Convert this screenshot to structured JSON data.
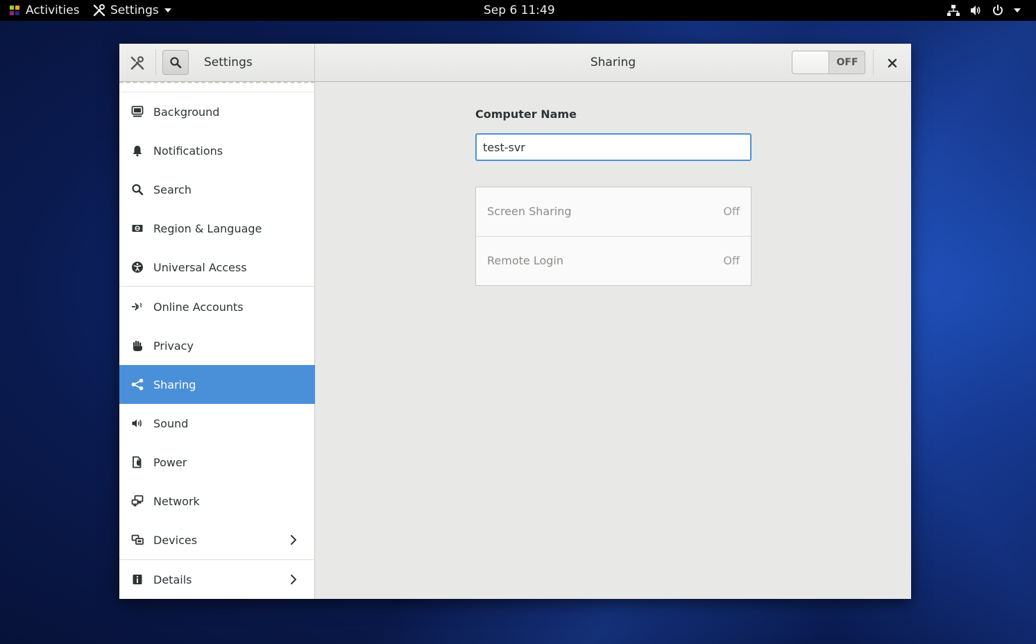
{
  "topbar": {
    "activities": "Activities",
    "app_menu": "Settings",
    "clock": "Sep 6  11:49"
  },
  "window": {
    "sidebar_title": "Settings",
    "page_title": "Sharing",
    "master_switch": {
      "label": "OFF",
      "state": "off"
    }
  },
  "sidebar": {
    "items": [
      {
        "label": "Background",
        "icon": "background-icon"
      },
      {
        "label": "Notifications",
        "icon": "bell-icon"
      },
      {
        "label": "Search",
        "icon": "search-icon"
      },
      {
        "label": "Region & Language",
        "icon": "region-icon"
      },
      {
        "label": "Universal Access",
        "icon": "accessibility-icon"
      },
      {
        "label": "Online Accounts",
        "icon": "online-accounts-icon"
      },
      {
        "label": "Privacy",
        "icon": "hand-icon"
      },
      {
        "label": "Sharing",
        "icon": "share-icon",
        "active": true
      },
      {
        "label": "Sound",
        "icon": "speaker-icon"
      },
      {
        "label": "Power",
        "icon": "power-plug-icon"
      },
      {
        "label": "Network",
        "icon": "network-icon"
      },
      {
        "label": "Devices",
        "icon": "devices-icon",
        "has_submenu": true
      },
      {
        "label": "Details",
        "icon": "info-icon",
        "has_submenu": true
      }
    ]
  },
  "content": {
    "computer_name_label": "Computer Name",
    "computer_name_value": "test-svr",
    "services": [
      {
        "name": "Screen Sharing",
        "state": "Off"
      },
      {
        "name": "Remote Login",
        "state": "Off"
      }
    ]
  },
  "colors": {
    "accent": "#4a90d9",
    "window_bg": "#e8e8e7",
    "topbar_bg": "#000000"
  }
}
